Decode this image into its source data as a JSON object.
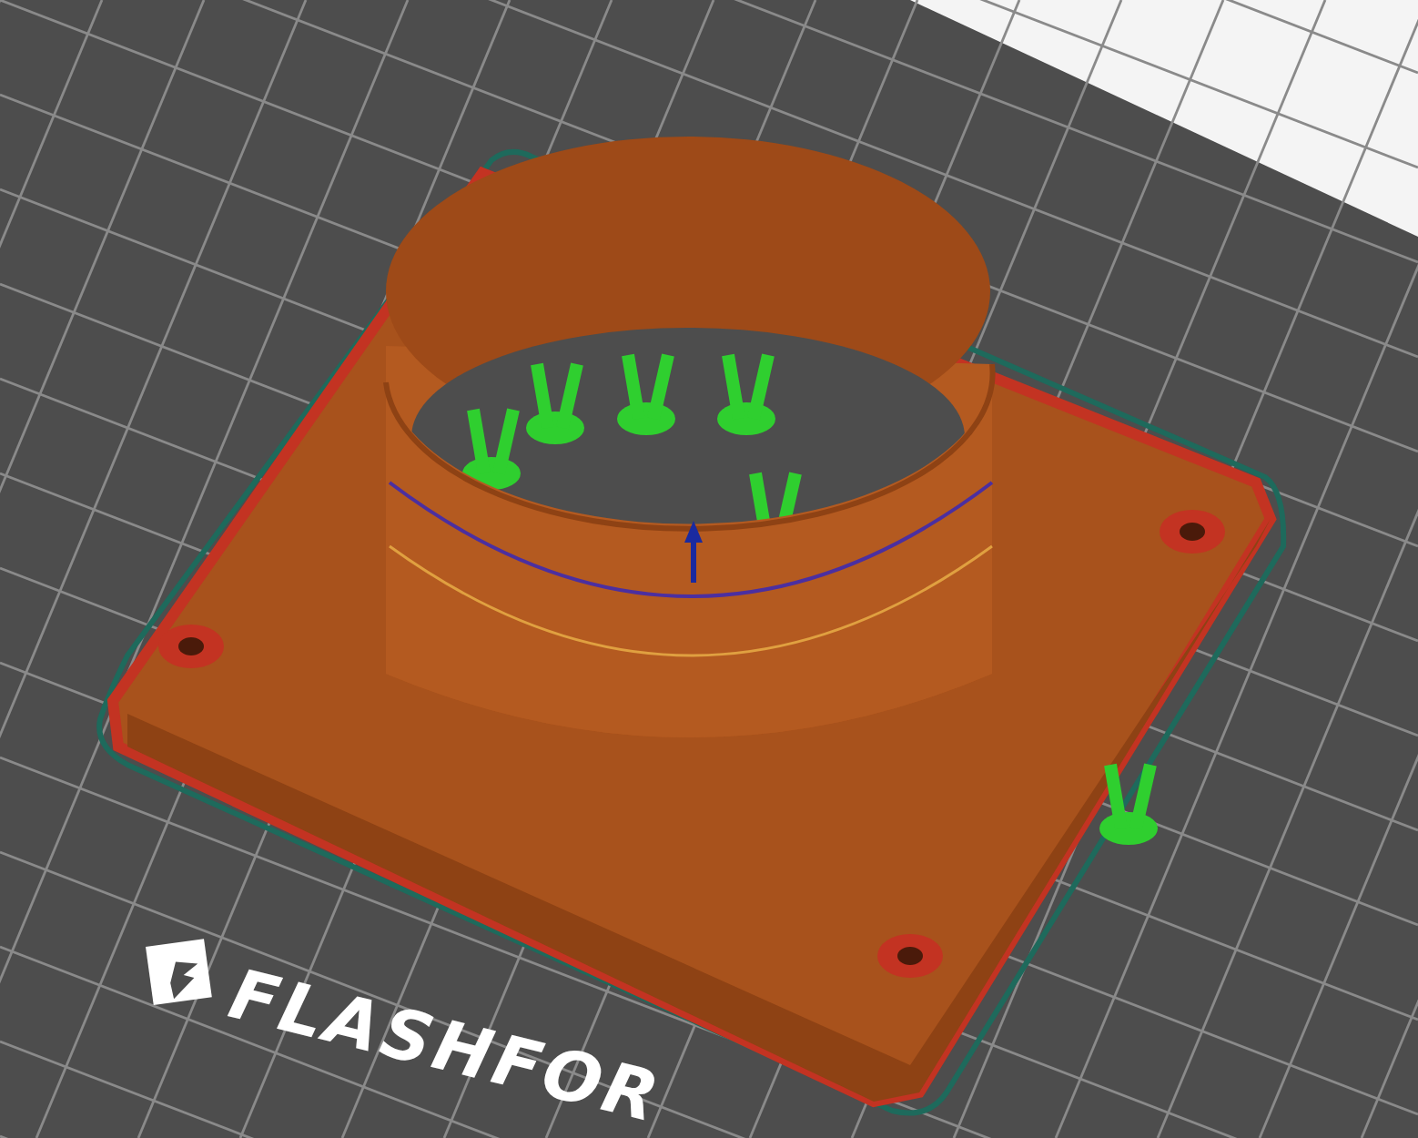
{
  "viewport": {
    "bed_logo": {
      "text": "FLASHFOR"
    }
  }
}
